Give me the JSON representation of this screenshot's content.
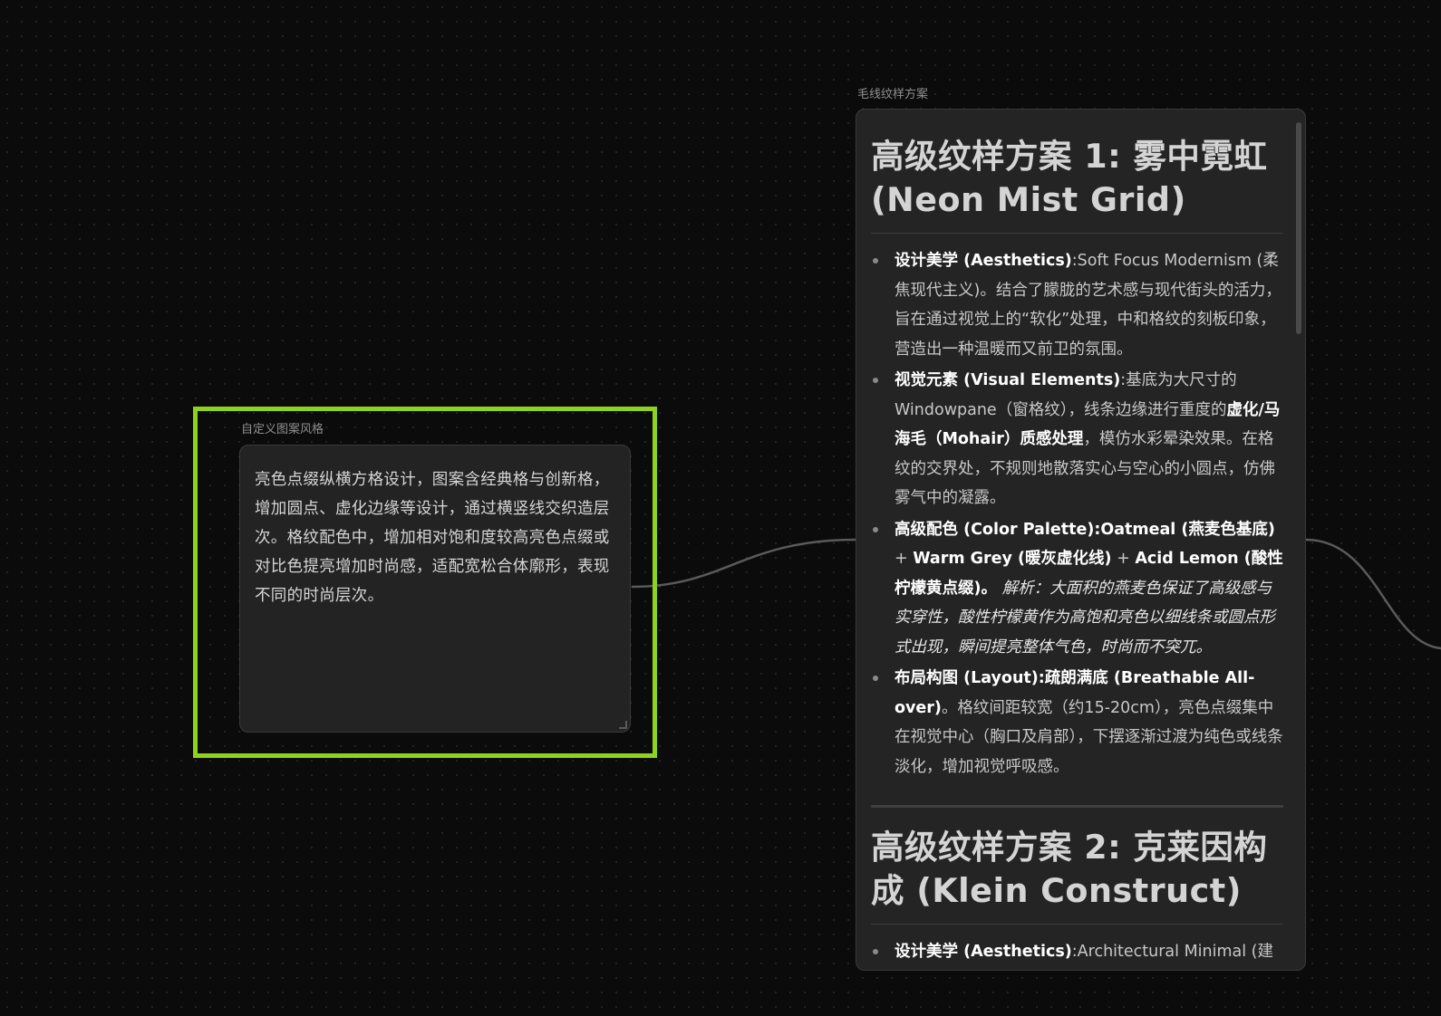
{
  "canvas": {
    "background": "#0b0b0b",
    "dot_color": "#262626",
    "edge_color": "#5a5a5a"
  },
  "input_node": {
    "label": "自定义图案风格",
    "text": "亮色点缀纵横方格设计，图案含经典格与创新格，增加圆点、虚化边缘等设计，通过横竖线交织造层次。格纹配色中，增加相对饱和度较高亮色点缀或对比色提亮增加时尚感，适配宽松合体廓形，表现不同的时尚层次。",
    "selection_color": "#8fd21d"
  },
  "output_node": {
    "label": "毛线纹样方案",
    "plan1": {
      "title": "高级纹样方案 1: 雾中霓虹 (Neon Mist Grid)",
      "items": [
        {
          "key": "设计美学 (Aesthetics)",
          "sep": ":",
          "text": "Soft Focus Modernism (柔焦现代主义)。结合了朦胧的艺术感与现代街头的活力，旨在通过视觉上的“软化”处理，中和格纹的刻板印象，营造出一种温暖而又前卫的氛围。"
        },
        {
          "key": "视觉元素 (Visual Elements)",
          "sep": ":",
          "text_a": "基底为大尺寸的Windowpane（窗格纹），线条边缘进行重度的",
          "bold_b": "虚化/马海毛（Mohair）质感处理",
          "text_c": "，模仿水彩晕染效果。在格纹的交界处，不规则地散落实心与空心的小圆点，仿佛雾气中的凝露。"
        },
        {
          "key": "高级配色 (Color Palette):",
          "bold_a": "Oatmeal (燕麦色基底)",
          "plus_1": " + ",
          "bold_b": "Warm Grey (暖灰虚化线)",
          "plus_2": " + ",
          "bold_c": "Acid Lemon (酸性柠檬黄点缀)",
          "dot": "。",
          "italic": "解析：大面积的燕麦色保证了高级感与实穿性，酸性柠檬黄作为高饱和亮色以细线条或圆点形式出现，瞬间提亮整体气色，时尚而不突兀。"
        },
        {
          "key": "布局构图 (Layout):",
          "bold_a": "疏朗满底 (Breathable All-over)",
          "text": "。格纹间距较宽（约15-20cm），亮色点缀集中在视觉中心（胸口及肩部），下摆逐渐过渡为纯色或线条淡化，增加视觉呼吸感。"
        }
      ]
    },
    "plan2": {
      "title": "高级纹样方案 2: 克莱因构成 (Klein Construct)",
      "first_item_key": "设计美学 (Aesthetics)",
      "first_item_sep": ":",
      "first_item_text": "Architectural Minimal (建筑"
    }
  }
}
